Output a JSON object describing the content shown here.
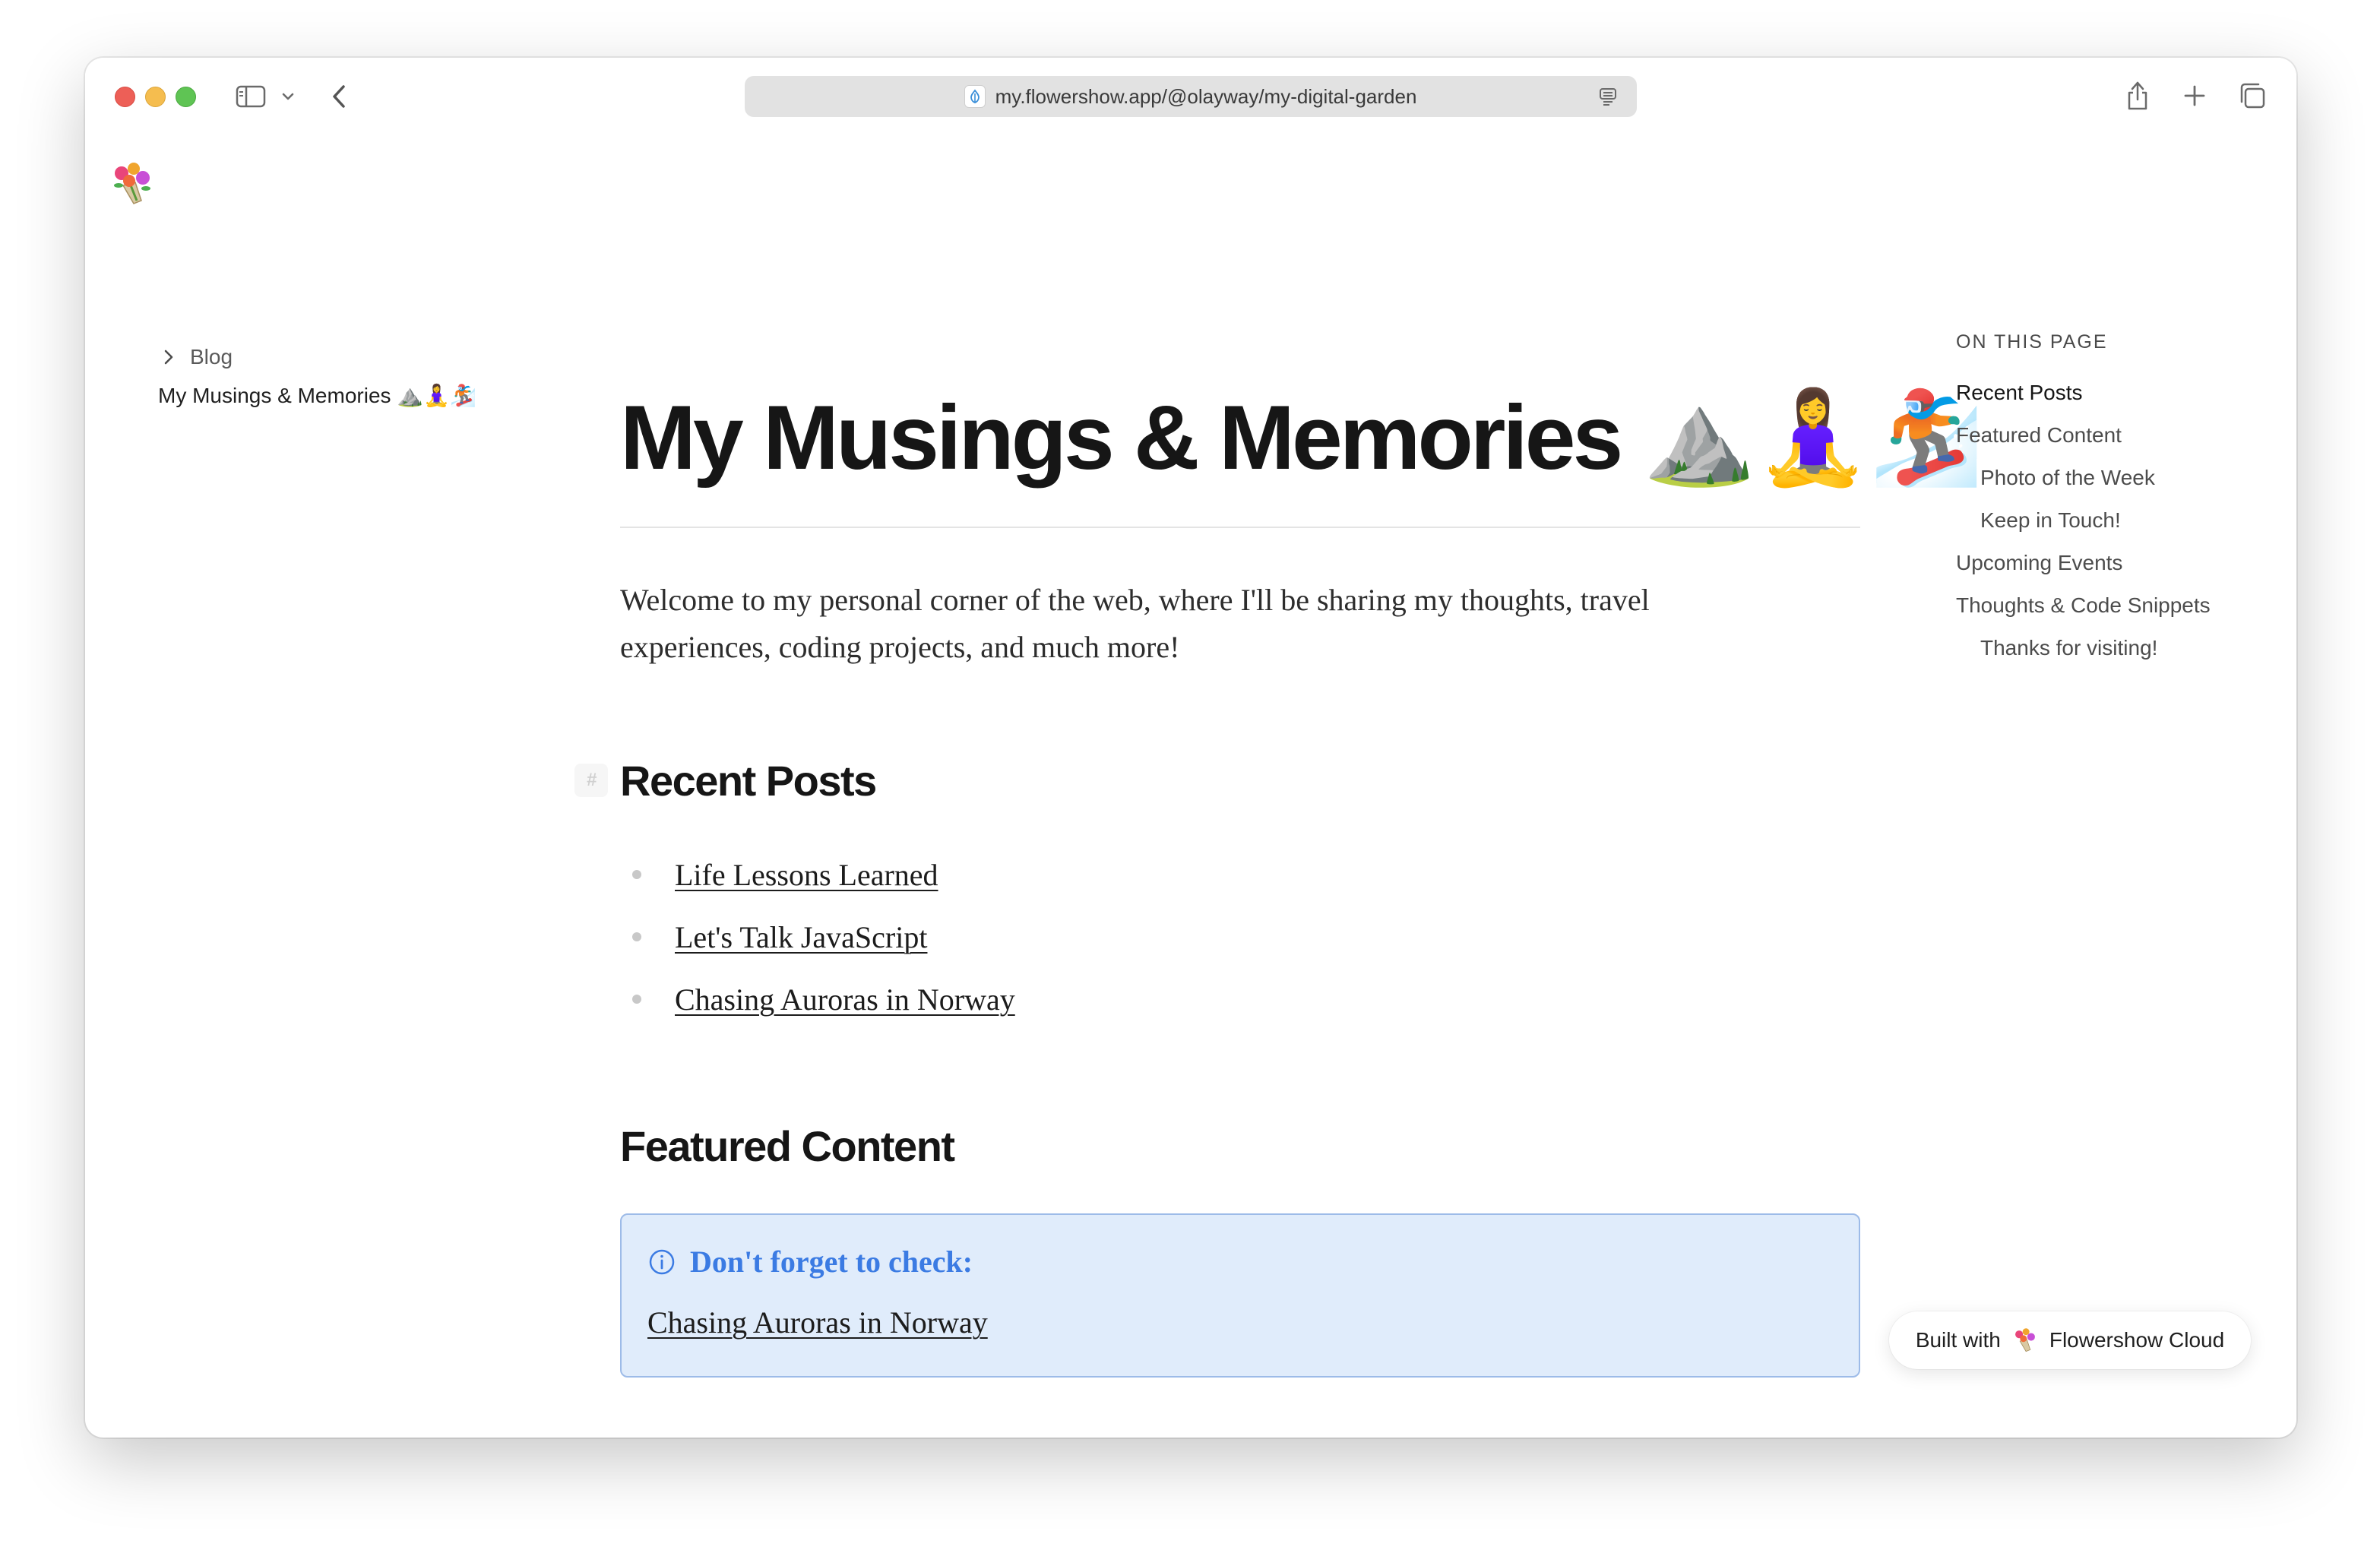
{
  "browser": {
    "url": "my.flowershow.app/@olayway/my-digital-garden",
    "icons": [
      "sidebar-icon",
      "chevron-down-icon",
      "chevron-left-icon",
      "reader-icon",
      "share-icon",
      "plus-icon",
      "tabs-icon"
    ]
  },
  "sidebar": {
    "blog_label": "Blog",
    "current_label": "My Musings & Memories ⛰️🧘‍♀️🏂"
  },
  "main": {
    "title": "My Musings & Memories",
    "title_emoji": "⛰️🧘‍♀️🏂",
    "intro": "Welcome to my personal corner of the web, where I'll be sharing my thoughts, travel experiences, coding projects, and much more!",
    "recent_heading": "Recent Posts",
    "anchor": "#",
    "posts": [
      "Life Lessons Learned",
      "Let's Talk JavaScript",
      "Chasing Auroras in Norway"
    ],
    "featured_heading": "Featured Content",
    "callout": {
      "title": "Don't forget to check:",
      "link": "Chasing Auroras in Norway"
    }
  },
  "toc": {
    "heading": "ON THIS PAGE",
    "items": [
      {
        "label": "Recent Posts"
      },
      {
        "label": "Featured Content"
      },
      {
        "label": "Photo of the Week"
      },
      {
        "label": "Keep in Touch!"
      },
      {
        "label": "Upcoming Events"
      },
      {
        "label": "Thoughts & Code Snippets"
      },
      {
        "label": "Thanks for visiting!"
      }
    ]
  },
  "badge": {
    "prefix": "Built with",
    "brand": "Flowershow Cloud"
  },
  "colors": {
    "accent_blue": "#3b7be3",
    "callout_bg": "#e0ecfb",
    "callout_border": "#9dbbe8",
    "traffic_close": "#ed5f57",
    "traffic_min": "#f5bd4f",
    "traffic_max": "#5fc454"
  }
}
